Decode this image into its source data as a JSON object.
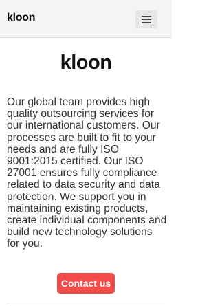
{
  "header": {
    "brand": "kloon",
    "menu_icon": "hamburger-menu-icon"
  },
  "hero": {
    "logo_text": "kloon",
    "description": "Our global team provides high quality outsourcing services for our international customers. Our processes are built to fit to your needs and are fully ISO 9001:2015 certified. Our ISO 27001 ensures fully compliance related to data security and data protection. We support you in maintaining existing products, create individual components and build new technology solutions for you.",
    "cta_label": "Contact us"
  },
  "colors": {
    "accent": "#f04d4a",
    "header_bg": "#f4f4f4",
    "text": "#333333"
  }
}
